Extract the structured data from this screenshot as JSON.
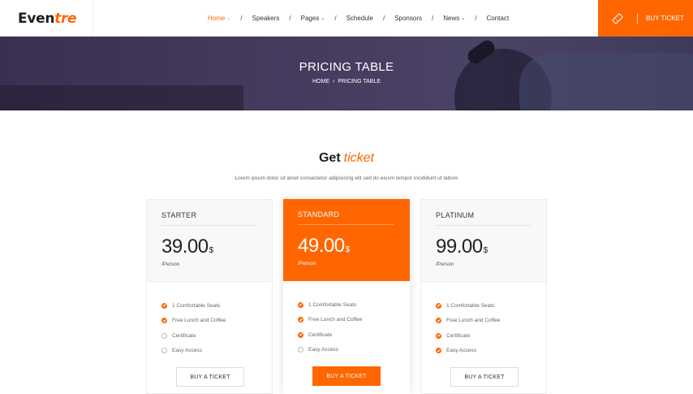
{
  "logo": {
    "part1": "Even",
    "part2": "tre"
  },
  "nav": {
    "items": [
      {
        "label": "Home",
        "caret": true,
        "active": true
      },
      {
        "label": "Speakers",
        "caret": false,
        "active": false
      },
      {
        "label": "Pages",
        "caret": true,
        "active": false
      },
      {
        "label": "Schedule",
        "caret": false,
        "active": false
      },
      {
        "label": "Sponsors",
        "caret": false,
        "active": false
      },
      {
        "label": "News",
        "caret": true,
        "active": false
      },
      {
        "label": "Contact",
        "caret": false,
        "active": false
      }
    ],
    "separator": "/",
    "caret_glyph": "⌄",
    "buy_ticket": "BUY TICKET"
  },
  "banner": {
    "title": "PRICING TABLE",
    "breadcrumb": [
      "HOME",
      "PRICING TABLE"
    ],
    "breadcrumb_sep": "›"
  },
  "section": {
    "title": "Get",
    "title_accent": "ticket",
    "subtitle": "Lorem ipsum dolor sit amet consectetur adipisicing elit sed do eiusm tempor incididunt ut labore"
  },
  "plans": [
    {
      "name": "STARTER",
      "price": "39.00",
      "currency": "$",
      "per": "/Person",
      "featured": false,
      "features": [
        {
          "text": "1 Comfortable Seats",
          "included": true
        },
        {
          "text": "Free Lunch and Coffee",
          "included": true
        },
        {
          "text": "Certificate",
          "included": false
        },
        {
          "text": "Easy Access",
          "included": false
        }
      ],
      "button": "BUY A TICKET"
    },
    {
      "name": "STANDARD",
      "price": "49.00",
      "currency": "$",
      "per": "/Person",
      "featured": true,
      "features": [
        {
          "text": "1 Comfortable Seats",
          "included": true
        },
        {
          "text": "Free Lunch and Coffee",
          "included": true
        },
        {
          "text": "Certificate",
          "included": true
        },
        {
          "text": "Easy Access",
          "included": false
        }
      ],
      "button": "BUY A TICKET"
    },
    {
      "name": "PLATINUM",
      "price": "99.00",
      "currency": "$",
      "per": "/Person",
      "featured": false,
      "features": [
        {
          "text": "1 Comfortable Seats",
          "included": true
        },
        {
          "text": "Free Lunch and Coffee",
          "included": true
        },
        {
          "text": "Certificate",
          "included": true
        },
        {
          "text": "Easy Access",
          "included": true
        }
      ],
      "button": "BUY A TICKET"
    }
  ],
  "colors": {
    "accent": "#ff6600",
    "banner": "#463a5e",
    "text": "#1d1d1d"
  }
}
